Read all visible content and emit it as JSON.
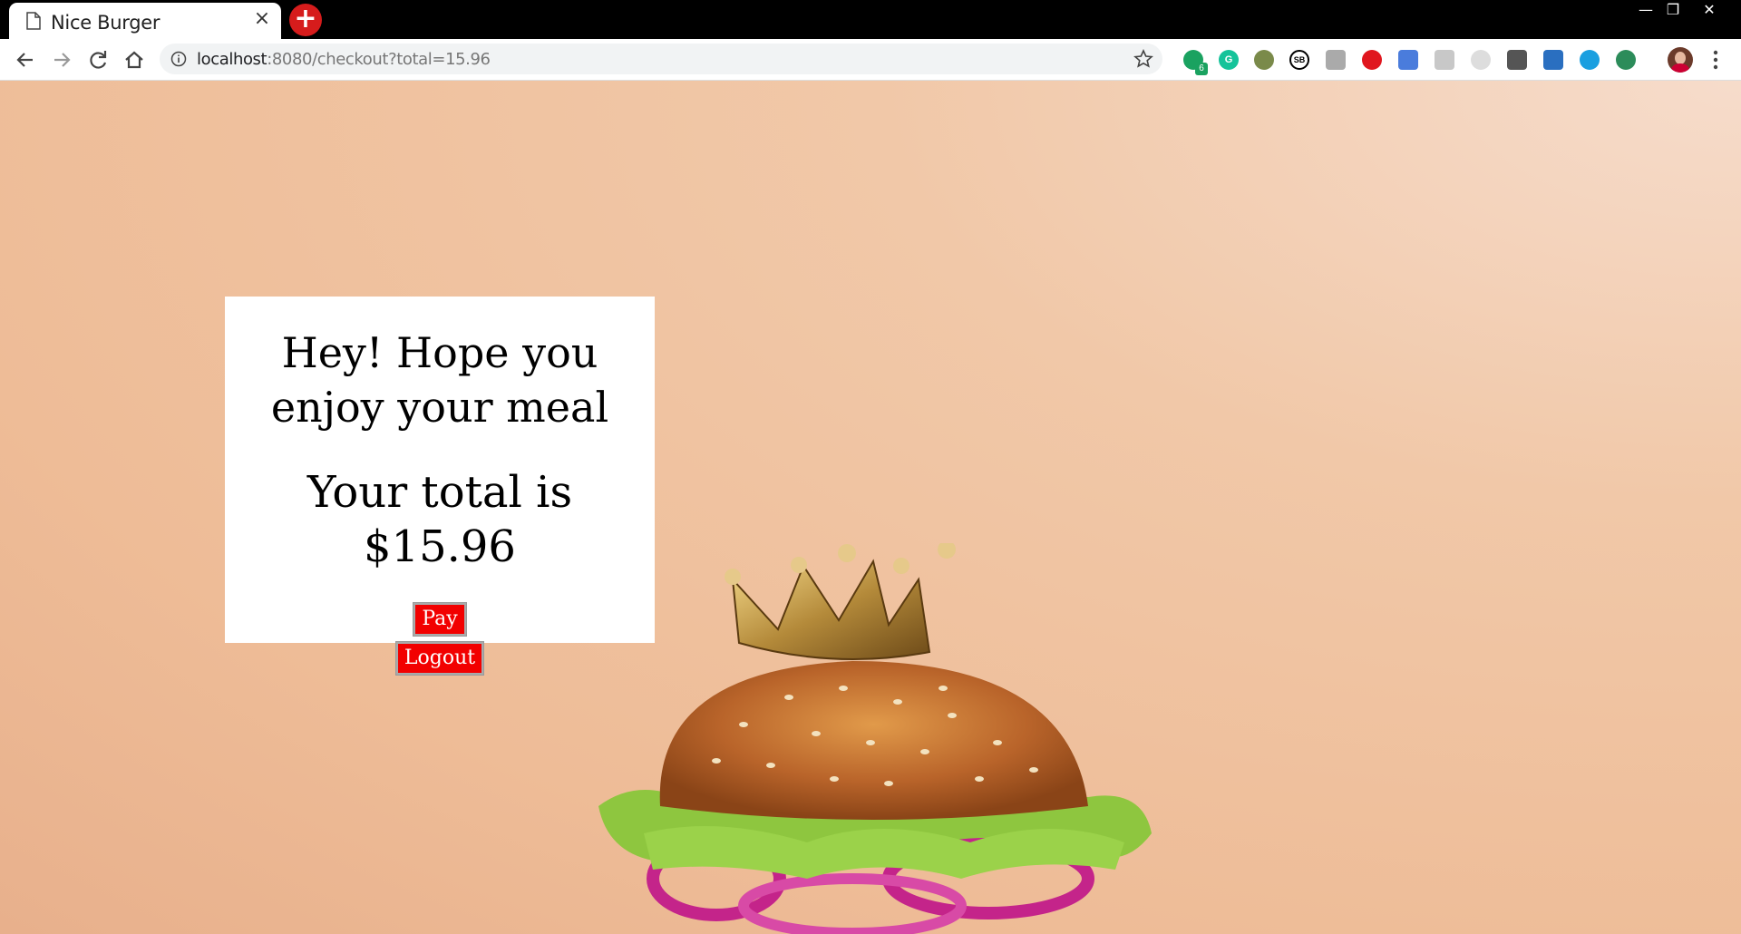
{
  "browser": {
    "tab_title": "Nice Burger",
    "tab_close": "×",
    "new_tab": "+",
    "window_controls": [
      "—",
      "❐",
      "✕"
    ],
    "url_host": "localhost",
    "url_rest": ":8080/checkout?total=15.96",
    "extensions_badge": "6",
    "extension_labels": [
      "SB",
      "G"
    ]
  },
  "checkout": {
    "greeting": "Hey! Hope you enjoy your meal",
    "total_text": "Your total is $15.96",
    "pay_label": "Pay",
    "logout_label": "Logout"
  },
  "colors": {
    "accent_button": "#f20000",
    "background": "#f0c6a6"
  }
}
